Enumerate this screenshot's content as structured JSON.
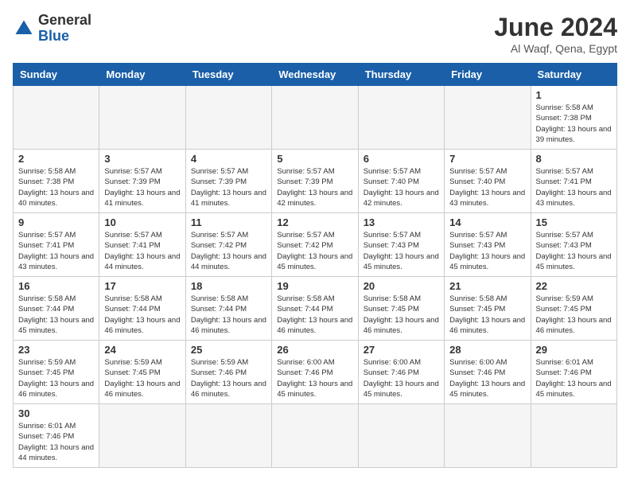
{
  "header": {
    "logo_general": "General",
    "logo_blue": "Blue",
    "month_title": "June 2024",
    "location": "Al Waqf, Qena, Egypt"
  },
  "days_of_week": [
    "Sunday",
    "Monday",
    "Tuesday",
    "Wednesday",
    "Thursday",
    "Friday",
    "Saturday"
  ],
  "weeks": [
    [
      {
        "day": "",
        "info": ""
      },
      {
        "day": "",
        "info": ""
      },
      {
        "day": "",
        "info": ""
      },
      {
        "day": "",
        "info": ""
      },
      {
        "day": "",
        "info": ""
      },
      {
        "day": "",
        "info": ""
      },
      {
        "day": "1",
        "info": "Sunrise: 5:58 AM\nSunset: 7:38 PM\nDaylight: 13 hours and 39 minutes."
      }
    ],
    [
      {
        "day": "2",
        "info": "Sunrise: 5:58 AM\nSunset: 7:38 PM\nDaylight: 13 hours and 40 minutes."
      },
      {
        "day": "3",
        "info": "Sunrise: 5:57 AM\nSunset: 7:39 PM\nDaylight: 13 hours and 41 minutes."
      },
      {
        "day": "4",
        "info": "Sunrise: 5:57 AM\nSunset: 7:39 PM\nDaylight: 13 hours and 41 minutes."
      },
      {
        "day": "5",
        "info": "Sunrise: 5:57 AM\nSunset: 7:39 PM\nDaylight: 13 hours and 42 minutes."
      },
      {
        "day": "6",
        "info": "Sunrise: 5:57 AM\nSunset: 7:40 PM\nDaylight: 13 hours and 42 minutes."
      },
      {
        "day": "7",
        "info": "Sunrise: 5:57 AM\nSunset: 7:40 PM\nDaylight: 13 hours and 43 minutes."
      },
      {
        "day": "8",
        "info": "Sunrise: 5:57 AM\nSunset: 7:41 PM\nDaylight: 13 hours and 43 minutes."
      }
    ],
    [
      {
        "day": "9",
        "info": "Sunrise: 5:57 AM\nSunset: 7:41 PM\nDaylight: 13 hours and 43 minutes."
      },
      {
        "day": "10",
        "info": "Sunrise: 5:57 AM\nSunset: 7:41 PM\nDaylight: 13 hours and 44 minutes."
      },
      {
        "day": "11",
        "info": "Sunrise: 5:57 AM\nSunset: 7:42 PM\nDaylight: 13 hours and 44 minutes."
      },
      {
        "day": "12",
        "info": "Sunrise: 5:57 AM\nSunset: 7:42 PM\nDaylight: 13 hours and 45 minutes."
      },
      {
        "day": "13",
        "info": "Sunrise: 5:57 AM\nSunset: 7:43 PM\nDaylight: 13 hours and 45 minutes."
      },
      {
        "day": "14",
        "info": "Sunrise: 5:57 AM\nSunset: 7:43 PM\nDaylight: 13 hours and 45 minutes."
      },
      {
        "day": "15",
        "info": "Sunrise: 5:57 AM\nSunset: 7:43 PM\nDaylight: 13 hours and 45 minutes."
      }
    ],
    [
      {
        "day": "16",
        "info": "Sunrise: 5:58 AM\nSunset: 7:44 PM\nDaylight: 13 hours and 45 minutes."
      },
      {
        "day": "17",
        "info": "Sunrise: 5:58 AM\nSunset: 7:44 PM\nDaylight: 13 hours and 46 minutes."
      },
      {
        "day": "18",
        "info": "Sunrise: 5:58 AM\nSunset: 7:44 PM\nDaylight: 13 hours and 46 minutes."
      },
      {
        "day": "19",
        "info": "Sunrise: 5:58 AM\nSunset: 7:44 PM\nDaylight: 13 hours and 46 minutes."
      },
      {
        "day": "20",
        "info": "Sunrise: 5:58 AM\nSunset: 7:45 PM\nDaylight: 13 hours and 46 minutes."
      },
      {
        "day": "21",
        "info": "Sunrise: 5:58 AM\nSunset: 7:45 PM\nDaylight: 13 hours and 46 minutes."
      },
      {
        "day": "22",
        "info": "Sunrise: 5:59 AM\nSunset: 7:45 PM\nDaylight: 13 hours and 46 minutes."
      }
    ],
    [
      {
        "day": "23",
        "info": "Sunrise: 5:59 AM\nSunset: 7:45 PM\nDaylight: 13 hours and 46 minutes."
      },
      {
        "day": "24",
        "info": "Sunrise: 5:59 AM\nSunset: 7:45 PM\nDaylight: 13 hours and 46 minutes."
      },
      {
        "day": "25",
        "info": "Sunrise: 5:59 AM\nSunset: 7:46 PM\nDaylight: 13 hours and 46 minutes."
      },
      {
        "day": "26",
        "info": "Sunrise: 6:00 AM\nSunset: 7:46 PM\nDaylight: 13 hours and 45 minutes."
      },
      {
        "day": "27",
        "info": "Sunrise: 6:00 AM\nSunset: 7:46 PM\nDaylight: 13 hours and 45 minutes."
      },
      {
        "day": "28",
        "info": "Sunrise: 6:00 AM\nSunset: 7:46 PM\nDaylight: 13 hours and 45 minutes."
      },
      {
        "day": "29",
        "info": "Sunrise: 6:01 AM\nSunset: 7:46 PM\nDaylight: 13 hours and 45 minutes."
      }
    ],
    [
      {
        "day": "30",
        "info": "Sunrise: 6:01 AM\nSunset: 7:46 PM\nDaylight: 13 hours and 44 minutes."
      },
      {
        "day": "",
        "info": ""
      },
      {
        "day": "",
        "info": ""
      },
      {
        "day": "",
        "info": ""
      },
      {
        "day": "",
        "info": ""
      },
      {
        "day": "",
        "info": ""
      },
      {
        "day": "",
        "info": ""
      }
    ]
  ]
}
